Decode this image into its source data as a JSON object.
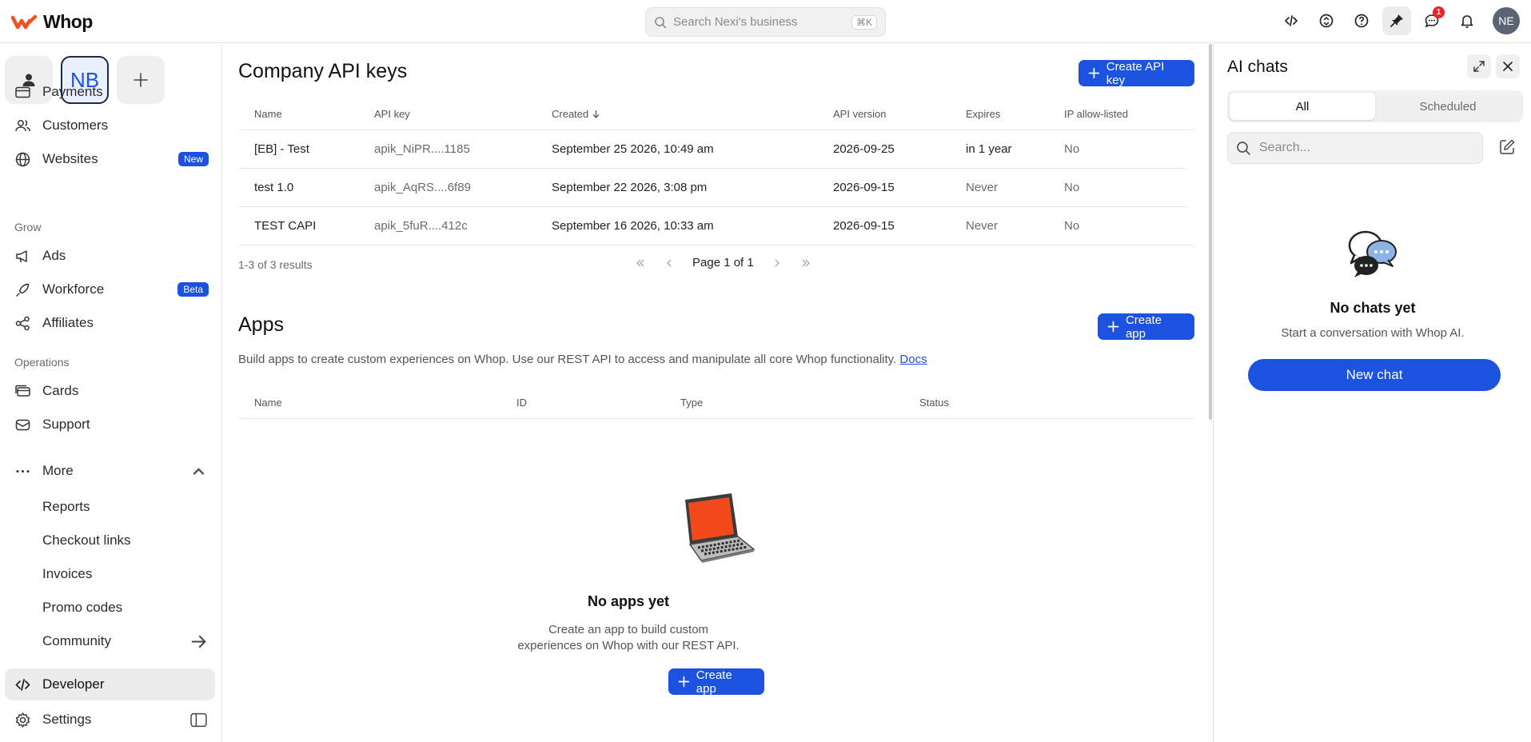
{
  "app": {
    "name": "Whop"
  },
  "search": {
    "placeholder": "Search Nexi's business",
    "shortcut": "⌘K"
  },
  "topbar": {
    "notification_count": "1",
    "avatar_initials": "NE"
  },
  "workspaces": {
    "active_initials": "NB"
  },
  "sidebar": {
    "items_top": [
      {
        "label": "Payments",
        "icon": "card-icon"
      },
      {
        "label": "Customers",
        "icon": "users-icon"
      },
      {
        "label": "Websites",
        "icon": "globe-icon",
        "badge": "New"
      }
    ],
    "grow_label": "Grow",
    "grow_items": [
      {
        "label": "Ads",
        "icon": "megaphone-icon"
      },
      {
        "label": "Workforce",
        "icon": "rocket-icon",
        "badge": "Beta"
      },
      {
        "label": "Affiliates",
        "icon": "share-icon"
      }
    ],
    "operations_label": "Operations",
    "operations_items": [
      {
        "label": "Cards",
        "icon": "cards-icon"
      },
      {
        "label": "Support",
        "icon": "mail-icon"
      }
    ],
    "more_label": "More",
    "more_items": [
      "Reports",
      "Checkout links",
      "Invoices",
      "Promo codes",
      "Community"
    ],
    "developer_label": "Developer",
    "settings_label": "Settings"
  },
  "api_keys": {
    "title": "Company API keys",
    "create_label": "Create API key",
    "columns": [
      "Name",
      "API key",
      "Created",
      "API version",
      "Expires",
      "IP allow-listed"
    ],
    "rows": [
      {
        "name": "[EB] - Test",
        "key": "apik_NiPR....1185",
        "created": "September 25 2026, 10:49 am",
        "version": "2026-09-25",
        "expires": "in 1 year",
        "ip": "No"
      },
      {
        "name": "test 1.0",
        "key": "apik_AqRS....6f89",
        "created": "September 22 2026, 3:08 pm",
        "version": "2026-09-15",
        "expires": "Never",
        "ip": "No"
      },
      {
        "name": "TEST CAPI",
        "key": "apik_5fuR....412c",
        "created": "September 16 2026, 10:33 am",
        "version": "2026-09-15",
        "expires": "Never",
        "ip": "No"
      }
    ],
    "results": "1-3 of 3 results",
    "page": "Page 1 of 1"
  },
  "apps": {
    "title": "Apps",
    "create_label": "Create app",
    "description": "Build apps to create custom experiences on Whop. Use our REST API to access and manipulate all core Whop functionality.",
    "docs_link": "Docs",
    "columns": [
      "Name",
      "ID",
      "Type",
      "Status"
    ],
    "empty_title": "No apps yet",
    "empty_sub_1": "Create an app to build custom",
    "empty_sub_2": "experiences on Whop with our REST API.",
    "empty_button": "Create app"
  },
  "ai_panel": {
    "title": "AI chats",
    "tabs": [
      "All",
      "Scheduled"
    ],
    "search_placeholder": "Search...",
    "empty_title": "No chats yet",
    "empty_sub": "Start a conversation with Whop AI.",
    "new_chat_label": "New chat"
  },
  "colors": {
    "accent": "#1c52e0",
    "logo": "#f2501f",
    "badge_red": "#e5242b"
  }
}
